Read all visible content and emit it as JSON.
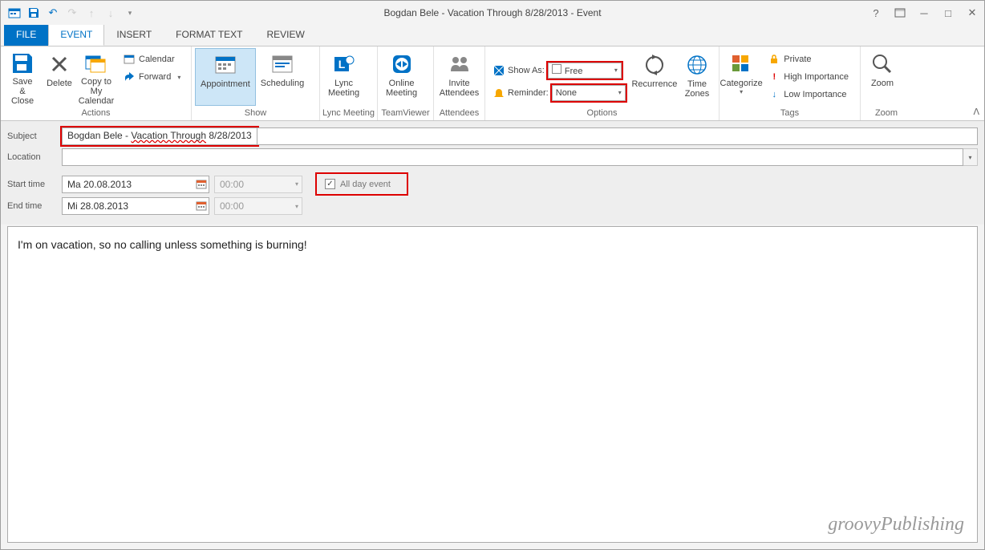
{
  "titlebar": {
    "title": "Bogdan Bele - Vacation Through 8/28/2013 - Event"
  },
  "tabs": {
    "file": "FILE",
    "event": "EVENT",
    "insert": "INSERT",
    "format_text": "FORMAT TEXT",
    "review": "REVIEW"
  },
  "ribbon": {
    "actions": {
      "label": "Actions",
      "save_close": "Save &\nClose",
      "delete": "Delete",
      "copy_calendar": "Copy to My\nCalendar",
      "calendar": "Calendar",
      "forward": "Forward"
    },
    "show": {
      "label": "Show",
      "appointment": "Appointment",
      "scheduling": "Scheduling"
    },
    "lync": {
      "label": "Lync Meeting",
      "btn": "Lync\nMeeting"
    },
    "tv": {
      "label": "TeamViewer",
      "btn": "Online\nMeeting"
    },
    "attendees": {
      "label": "Attendees",
      "btn": "Invite\nAttendees"
    },
    "options": {
      "label": "Options",
      "show_as_label": "Show As:",
      "show_as_value": "Free",
      "reminder_label": "Reminder:",
      "reminder_value": "None",
      "recurrence": "Recurrence",
      "time_zones": "Time\nZones"
    },
    "tags": {
      "label": "Tags",
      "categorize": "Categorize",
      "private": "Private",
      "high": "High Importance",
      "low": "Low Importance"
    },
    "zoom": {
      "label": "Zoom",
      "btn": "Zoom"
    }
  },
  "form": {
    "subject_label": "Subject",
    "subject_value_prefix": "Bogdan Bele - ",
    "subject_value_underlined": "Vacation Through",
    "subject_value_suffix": " 8/28/2013",
    "location_label": "Location",
    "location_value": "",
    "start_label": "Start time",
    "start_date": "Ma 20.08.2013",
    "start_time": "00:00",
    "end_label": "End time",
    "end_date": "Mi 28.08.2013",
    "end_time": "00:00",
    "all_day_label": "All day event",
    "all_day_checked": true
  },
  "body": {
    "text": "I'm on vacation, so no calling unless something is burning!"
  },
  "watermark": "groovyPublishing"
}
